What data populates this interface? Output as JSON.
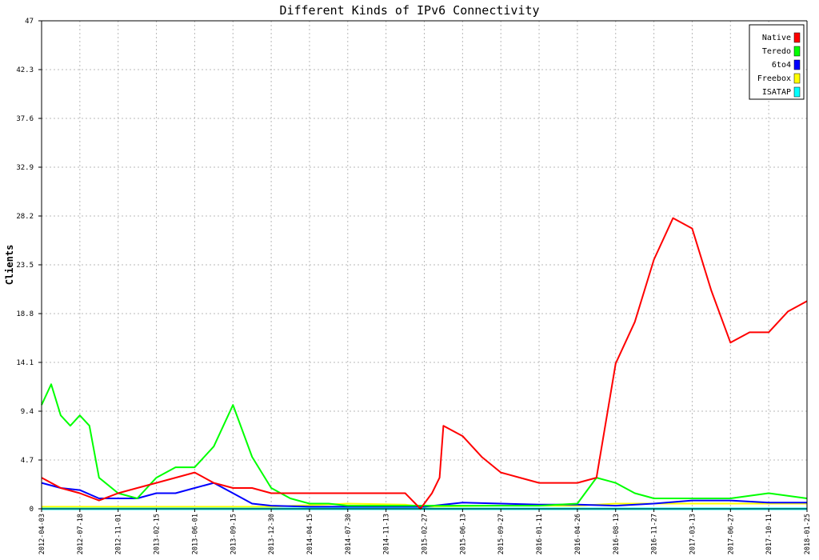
{
  "chart_data": {
    "type": "line",
    "title": "Different Kinds of IPv6 Connectivity",
    "xlabel": "",
    "ylabel": "Clients",
    "ylim": [
      0,
      47
    ],
    "yticks": [
      "0",
      "4.7",
      "9.4",
      "14.1",
      "18.8",
      "23.5",
      "28.2",
      "32.9",
      "37.6",
      "42.3",
      "47"
    ],
    "xticks": [
      "2012-04-03",
      "2012-07-18",
      "2012-11-01",
      "2013-02-15",
      "2013-06-01",
      "2013-09-15",
      "2013-12-30",
      "2014-04-15",
      "2014-07-30",
      "2014-11-13",
      "2015-02-27",
      "2015-06-13",
      "2015-09-27",
      "2016-01-11",
      "2016-04-26",
      "2016-08-13",
      "2016-11-27",
      "2017-03-13",
      "2017-06-27",
      "2017-10-11",
      "2018-01-25"
    ],
    "grid": true,
    "legend_position": "top-right",
    "series": [
      {
        "name": "Native",
        "color": "#ff0000",
        "x": [
          0,
          0.5,
          1,
          1.5,
          2,
          2.5,
          3,
          3.5,
          4,
          4.5,
          5,
          5.5,
          6,
          6.5,
          7,
          7.5,
          8,
          8.5,
          9,
          9.5,
          9.9,
          10.2,
          10.4,
          10.5,
          11,
          11.5,
          12,
          12.5,
          13,
          13.5,
          14,
          14.5,
          15,
          15.5,
          16,
          16.5,
          17,
          17.5,
          18,
          18.5,
          19,
          19.5,
          20
        ],
        "y": [
          3,
          2,
          1.5,
          0.8,
          1.5,
          2,
          2.5,
          3,
          3.5,
          2.5,
          2,
          2,
          1.5,
          1.5,
          1.5,
          1.5,
          1.5,
          1.5,
          1.5,
          1.5,
          0,
          1.5,
          3,
          8,
          7,
          5,
          3.5,
          3,
          2.5,
          2.5,
          2.5,
          3,
          14,
          18,
          24,
          28,
          27,
          21,
          16,
          17,
          17,
          19,
          20
        ]
      },
      {
        "name": "Teredo",
        "color": "#00ff00",
        "x": [
          0,
          0.25,
          0.5,
          0.75,
          1,
          1.25,
          1.5,
          2,
          2.5,
          3,
          3.5,
          4,
          4.5,
          5,
          5.5,
          6,
          6.5,
          7,
          7.5,
          8,
          9,
          10,
          11,
          12,
          13,
          14,
          14.5,
          15,
          15.5,
          16,
          17,
          18,
          19,
          20
        ],
        "y": [
          10,
          12,
          9,
          8,
          9,
          8,
          3,
          1.5,
          1,
          3,
          4,
          4,
          6,
          10,
          5,
          2,
          1,
          0.5,
          0.5,
          0.3,
          0.3,
          0.3,
          0.3,
          0.3,
          0.3,
          0.5,
          3,
          2.5,
          1.5,
          1,
          1,
          1,
          1.5,
          1
        ]
      },
      {
        "name": "6to4",
        "color": "#0000ff",
        "x": [
          0,
          0.5,
          1,
          1.5,
          2,
          2.5,
          3,
          3.5,
          4,
          4.5,
          5,
          5.5,
          6,
          7,
          8,
          9,
          10,
          11,
          12,
          13,
          14,
          15,
          16,
          17,
          18,
          19,
          20
        ],
        "y": [
          2.5,
          2,
          1.8,
          1,
          1,
          1,
          1.5,
          1.5,
          2,
          2.5,
          1.5,
          0.5,
          0.3,
          0.2,
          0.2,
          0.2,
          0.2,
          0.6,
          0.5,
          0.4,
          0.4,
          0.3,
          0.5,
          0.8,
          0.8,
          0.6,
          0.6
        ]
      },
      {
        "name": "Freebox",
        "color": "#ffff00",
        "x": [
          0,
          2,
          4,
          6,
          8,
          9.5,
          10,
          12,
          14,
          15,
          16,
          18,
          20
        ],
        "y": [
          0.2,
          0.2,
          0.2,
          0.2,
          0.5,
          0.4,
          0.2,
          0.3,
          0.3,
          0.5,
          0.5,
          0.5,
          0.5
        ]
      },
      {
        "name": "ISATAP",
        "color": "#00ffff",
        "x": [
          0,
          20
        ],
        "y": [
          0,
          0
        ]
      }
    ]
  }
}
